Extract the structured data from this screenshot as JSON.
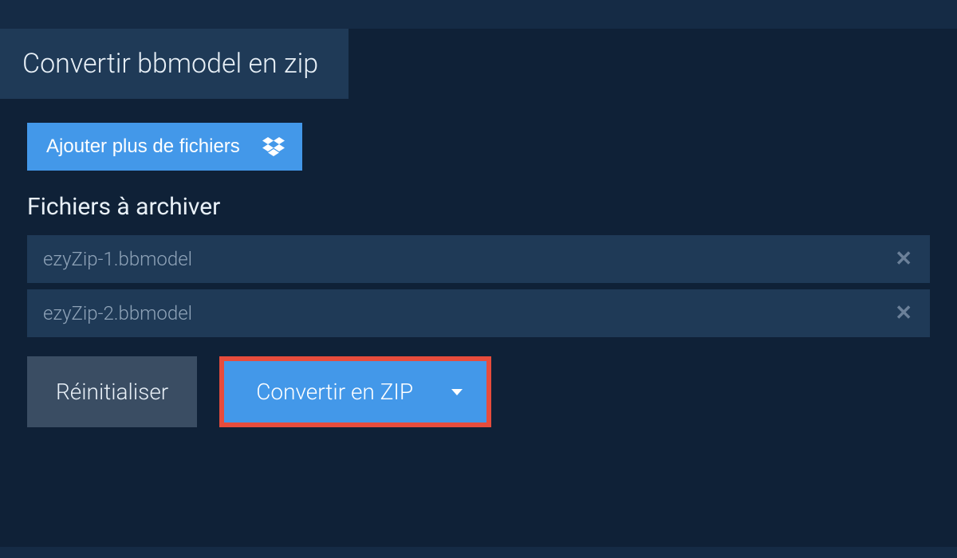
{
  "header": {
    "tab_title": "Convertir bbmodel en zip"
  },
  "add_files": {
    "label": "Ajouter plus de fichiers"
  },
  "section": {
    "title": "Fichiers à archiver"
  },
  "files": [
    {
      "name": "ezyZip-1.bbmodel"
    },
    {
      "name": "ezyZip-2.bbmodel"
    }
  ],
  "buttons": {
    "reset": "Réinitialiser",
    "convert": "Convertir en ZIP"
  },
  "colors": {
    "accent": "#4398e9",
    "highlight_border": "#e74c3c",
    "background": "#0f2137",
    "panel": "#1f3a57"
  }
}
